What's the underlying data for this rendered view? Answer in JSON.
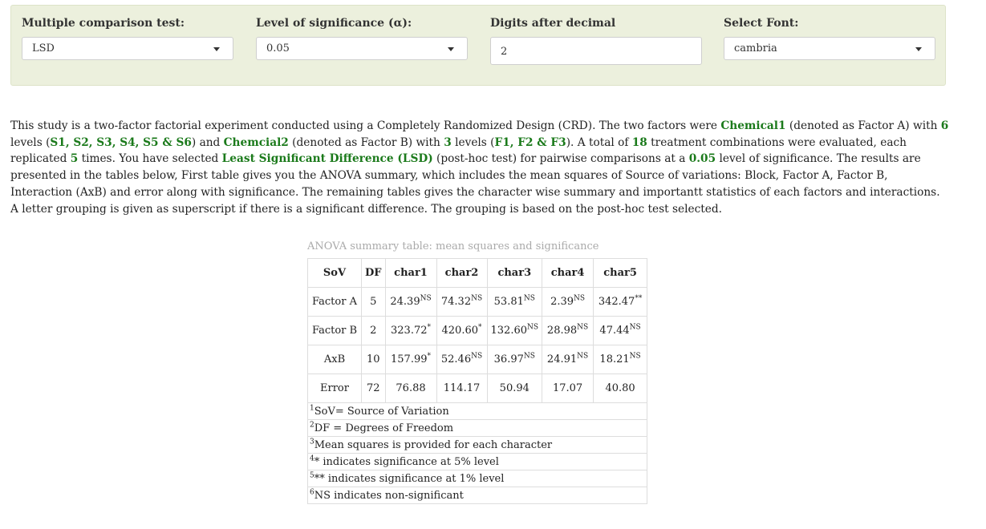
{
  "controls": {
    "test": {
      "label": "Multiple comparison test:",
      "value": "LSD"
    },
    "alpha": {
      "label": "Level of significance (α):",
      "value": "0.05"
    },
    "digits": {
      "label": "Digits after decimal",
      "value": "2"
    },
    "font": {
      "label": "Select Font:",
      "value": "cambria"
    }
  },
  "paragraph": {
    "p1": "This study is a two-factor factorial experiment conducted using a Completely Randomized Design (CRD). The two factors were ",
    "h1": "Chemical1",
    "p2": " (denoted as Factor A) with ",
    "h2": "6",
    "p3": " levels (",
    "h3": "S1, S2, S3, S4, S5 & S6",
    "p4": ") and ",
    "h4": "Chemcial2",
    "p5": " (denoted as Factor B) with ",
    "h5": "3",
    "p6": " levels (",
    "h6": "F1, F2 & F3",
    "p7": "). A total of ",
    "h7": "18",
    "p8": " treatment combinations were evaluated, each replicated ",
    "h8": "5",
    "p9": " times. You have selected ",
    "h9": "Least Significant Difference (LSD)",
    "p10": " (post-hoc test) for pairwise comparisons at a ",
    "h10": "0.05",
    "p11": " level of significance. The results are presented in the tables below, First table gives you the ANOVA summary, which includes the mean squares of Source of variations: Block, Factor A, Factor B, Interaction (AxB) and error along with significance. The remaining tables gives the character wise summary and importantt statistics of each factors and interactions. A letter grouping is given as superscript if there is a significant difference. The grouping is based on the post-hoc test selected."
  },
  "table": {
    "caption": "ANOVA summary table: mean squares and significance",
    "headers": [
      "SoV",
      "DF",
      "char1",
      "char2",
      "char3",
      "char4",
      "char5"
    ],
    "rows": [
      {
        "sov": "Factor A",
        "df": "5",
        "cells": [
          [
            "24.39",
            "NS"
          ],
          [
            "74.32",
            "NS"
          ],
          [
            "53.81",
            "NS"
          ],
          [
            "2.39",
            "NS"
          ],
          [
            "342.47",
            "**"
          ]
        ]
      },
      {
        "sov": "Factor B",
        "df": "2",
        "cells": [
          [
            "323.72",
            "*"
          ],
          [
            "420.60",
            "*"
          ],
          [
            "132.60",
            "NS"
          ],
          [
            "28.98",
            "NS"
          ],
          [
            "47.44",
            "NS"
          ]
        ]
      },
      {
        "sov": "AxB",
        "df": "10",
        "cells": [
          [
            "157.99",
            "*"
          ],
          [
            "52.46",
            "NS"
          ],
          [
            "36.97",
            "NS"
          ],
          [
            "24.91",
            "NS"
          ],
          [
            "18.21",
            "NS"
          ]
        ]
      },
      {
        "sov": "Error",
        "df": "72",
        "cells": [
          [
            "76.88",
            ""
          ],
          [
            "114.17",
            ""
          ],
          [
            "50.94",
            ""
          ],
          [
            "17.07",
            ""
          ],
          [
            "40.80",
            ""
          ]
        ]
      }
    ],
    "footnotes": [
      {
        "n": "1",
        "text": "SoV= Source of Variation"
      },
      {
        "n": "2",
        "text": "DF = Degrees of Freedom"
      },
      {
        "n": "3",
        "text": "Mean squares is provided for each character"
      },
      {
        "n": "4",
        "text": "* indicates significance at 5% level"
      },
      {
        "n": "5",
        "text": "** indicates significance at 1% level"
      },
      {
        "n": "6",
        "text": "NS indicates non-significant"
      }
    ]
  }
}
